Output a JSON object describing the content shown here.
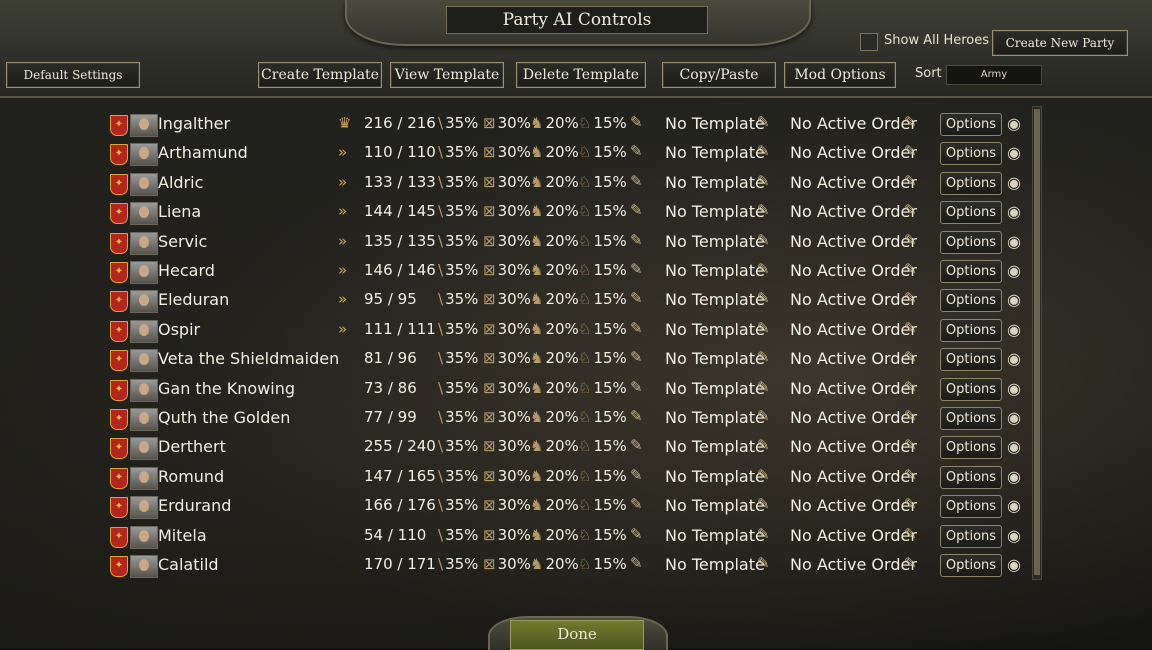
{
  "title": "Party AI Controls",
  "toolbar": {
    "default_settings": "Default Settings",
    "create_template": "Create Template",
    "view_template": "View Template",
    "delete_template": "Delete Template",
    "copy_paste": "Copy/Paste",
    "mod_options": "Mod Options",
    "show_all_heroes": "Show All Heroes",
    "create_new_party": "Create New Party",
    "sort_label": "Sort",
    "sort_value": "Army"
  },
  "common": {
    "pct1": "35%",
    "pct2": "30%",
    "pct3": "20%",
    "pct4": "15%",
    "template": "No Template",
    "order": "No Active Order",
    "options": "Options"
  },
  "parties": [
    {
      "name": "Ingalther",
      "troops": "216 / 216",
      "status_icon": "crown-icon",
      "banner_color": "#b3261e"
    },
    {
      "name": "Arthamund",
      "troops": "110 / 110",
      "status_icon": "army-arrow-icon",
      "banner_color": "#b3261e"
    },
    {
      "name": "Aldric",
      "troops": "133 / 133",
      "status_icon": "army-arrow-icon",
      "banner_color": "#b3261e"
    },
    {
      "name": "Liena",
      "troops": "144 / 145",
      "status_icon": "army-arrow-icon",
      "banner_color": "#b3261e"
    },
    {
      "name": "Servic",
      "troops": "135 / 135",
      "status_icon": "army-arrow-icon",
      "banner_color": "#b3261e"
    },
    {
      "name": "Hecard",
      "troops": "146 / 146",
      "status_icon": "army-arrow-icon",
      "banner_color": "#b3261e"
    },
    {
      "name": "Eleduran",
      "troops": "95 / 95",
      "status_icon": "army-arrow-icon",
      "banner_color": "#b3261e"
    },
    {
      "name": "Ospir",
      "troops": "111 / 111",
      "status_icon": "army-arrow-icon",
      "banner_color": "#b3261e"
    },
    {
      "name": "Veta the Shieldmaiden",
      "troops": "81 / 96",
      "status_icon": "",
      "banner_color": "#b3261e"
    },
    {
      "name": "Gan the Knowing",
      "troops": "73 / 86",
      "status_icon": "",
      "banner_color": "#b3261e"
    },
    {
      "name": "Quth the Golden",
      "troops": "77 / 99",
      "status_icon": "",
      "banner_color": "#b3261e"
    },
    {
      "name": "Derthert",
      "troops": "255 / 240",
      "status_icon": "",
      "banner_color": "#b3261e"
    },
    {
      "name": "Romund",
      "troops": "147 / 165",
      "status_icon": "",
      "banner_color": "#b3261e"
    },
    {
      "name": "Erdurand",
      "troops": "166 / 176",
      "status_icon": "",
      "banner_color": "#b3261e"
    },
    {
      "name": "Mitela",
      "troops": "54 / 110",
      "status_icon": "",
      "banner_color": "#b3261e"
    },
    {
      "name": "Calatild",
      "troops": "170 / 171",
      "status_icon": "",
      "banner_color": "#b3261e"
    }
  ],
  "done": "Done"
}
